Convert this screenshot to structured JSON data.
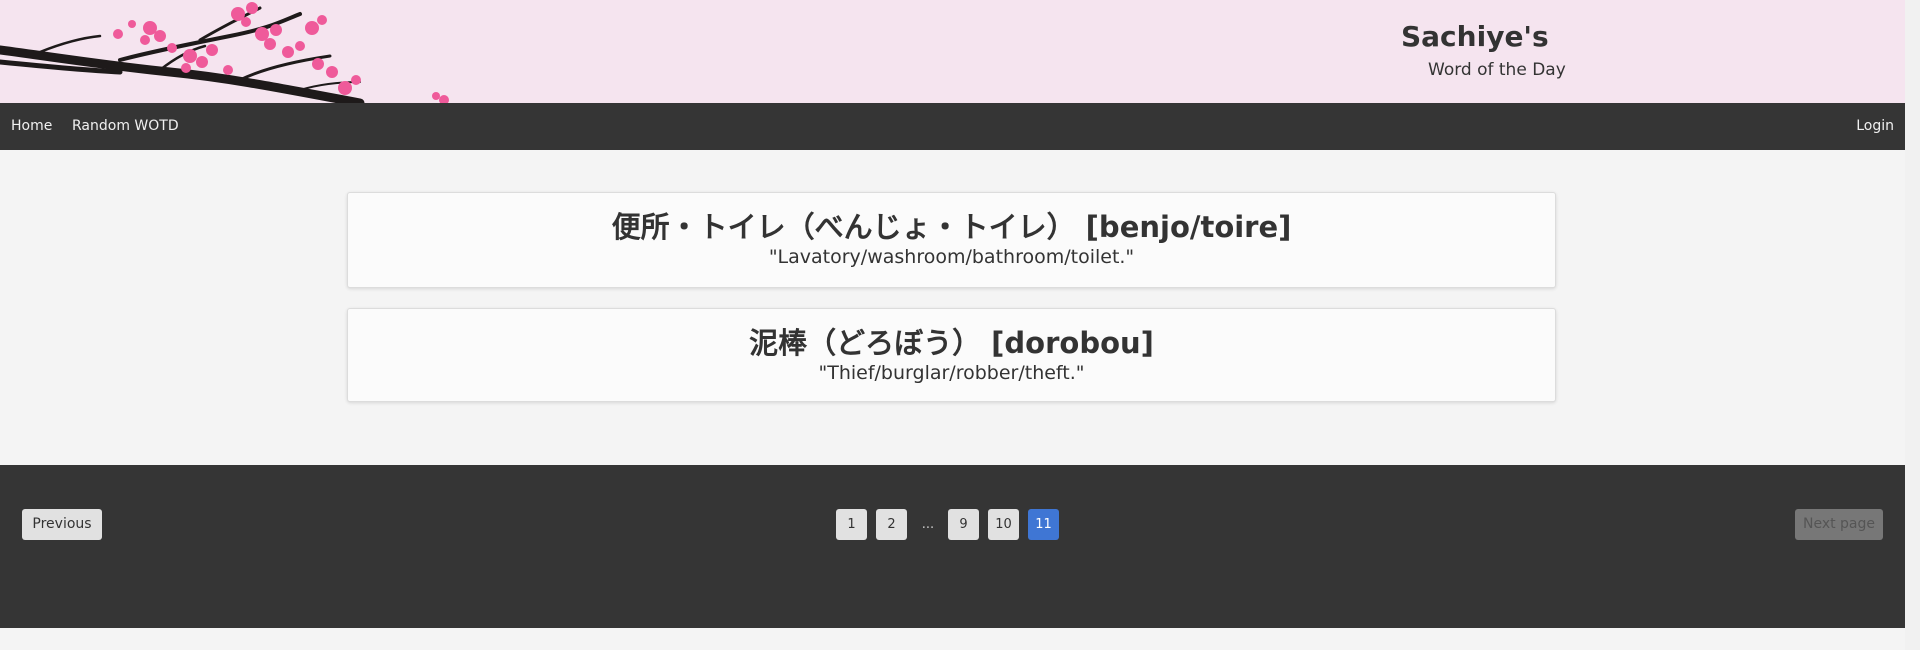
{
  "header": {
    "title": "Sachiye's",
    "subtitle": "Word of the Day"
  },
  "nav": {
    "home": "Home",
    "random": "Random WOTD",
    "login": "Login"
  },
  "words": [
    {
      "title": "便所・トイレ（べんじょ・トイレ） [benjo/toire]",
      "meaning": "\"Lavatory/washroom/bathroom/toilet.\""
    },
    {
      "title": "泥棒（どろぼう） [dorobou]",
      "meaning": "\"Thief/burglar/robber/theft.\""
    }
  ],
  "pagination": {
    "previous": "Previous",
    "next": "Next page",
    "pages": [
      "1",
      "2",
      "9",
      "10",
      "11"
    ],
    "ellipsis": "...",
    "current": "11"
  },
  "colors": {
    "header_bg": "#f5e4ef",
    "nav_bg": "#353535",
    "blossom": "#ef5a9a",
    "branch": "#1e1a1a",
    "active_page": "#3f76d4"
  }
}
